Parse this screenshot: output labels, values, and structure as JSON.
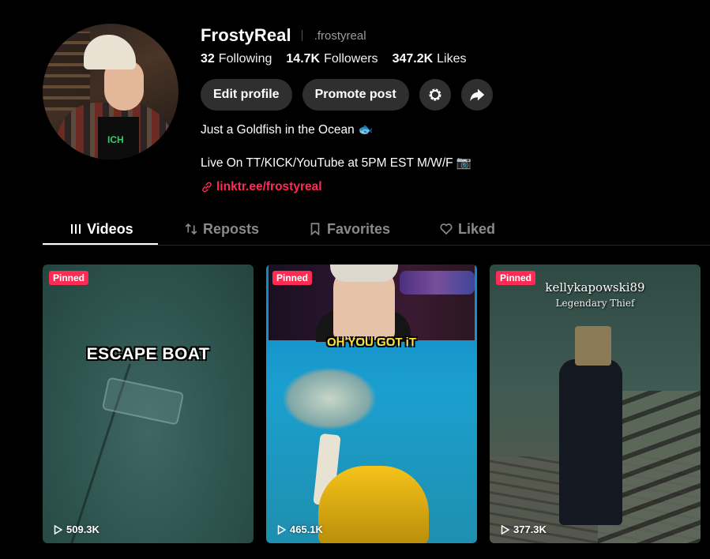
{
  "profile": {
    "username": "FrostyReal",
    "nickname": ".frostyreal",
    "stats": [
      {
        "value": "32",
        "label": "Following"
      },
      {
        "value": "14.7K",
        "label": "Followers"
      },
      {
        "value": "347.2K",
        "label": "Likes"
      }
    ],
    "buttons": {
      "edit_label": "Edit profile",
      "promote_label": "Promote post"
    },
    "bio_line1": "Just a Goldfish in the Ocean 🐟",
    "bio_line2": "Live On TT/KICK/YouTube at 5PM EST M/W/F 📷",
    "link": "linktr.ee/frostyreal",
    "link_color": "#fe2c55",
    "avatar_shirt_text": "ICH"
  },
  "tabs": [
    {
      "label": "Videos",
      "icon": "grid-icon",
      "active": true
    },
    {
      "label": "Reposts",
      "icon": "repost-icon",
      "active": false
    },
    {
      "label": "Favorites",
      "icon": "bookmark-icon",
      "active": false
    },
    {
      "label": "Liked",
      "icon": "heart-icon",
      "active": false
    }
  ],
  "videos": [
    {
      "badge": "Pinned",
      "views": "509.3K",
      "overlay": "ESCAPE BOAT"
    },
    {
      "badge": "Pinned",
      "views": "465.1K",
      "overlay": "OH YOU GOT iT"
    },
    {
      "badge": "Pinned",
      "views": "377.3K",
      "overlay": "kellykapowski89",
      "overlay_sub": "Legendary Thief"
    }
  ],
  "colors": {
    "accent": "#fe2c55",
    "background": "#000000",
    "button": "#2f2f2f"
  }
}
